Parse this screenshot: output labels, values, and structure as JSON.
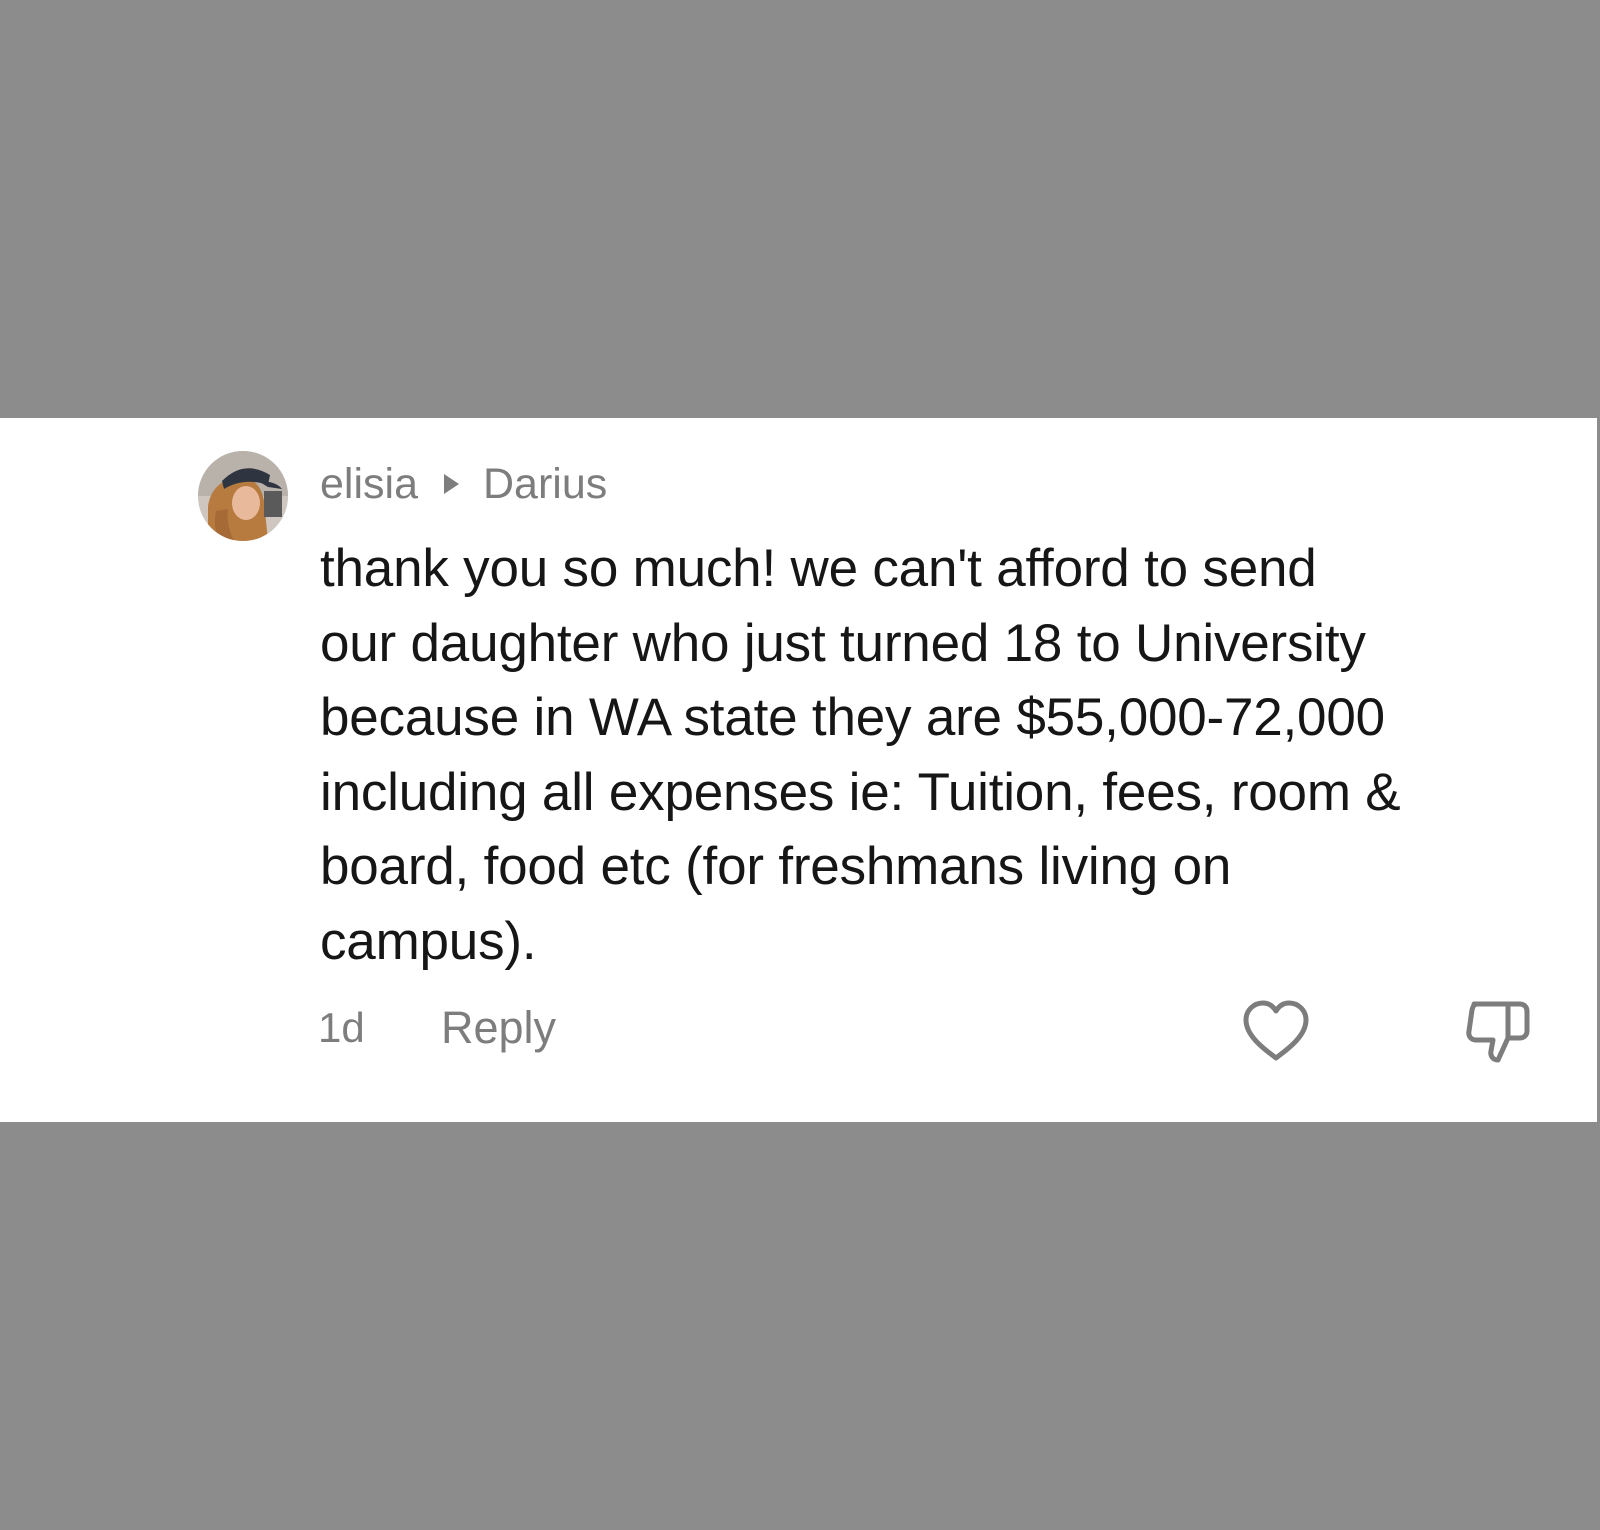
{
  "comment": {
    "author": "elisia",
    "reply_to": "Darius",
    "text_lines": [
      "thank you so much! we can't afford to send",
      "our daughter who just turned 18 to University",
      "because in WA state they are $55,000-72,000",
      "including all expenses ie: Tuition, fees, room &",
      "board, food etc (for freshmans living on",
      "campus)."
    ],
    "time": "1d",
    "reply_label": "Reply",
    "icons": {
      "avatar": "avatar-photo",
      "reply_arrow": "triangle-right-icon",
      "like": "heart-outline-icon",
      "dislike": "thumbs-down-outline-icon"
    }
  },
  "colors": {
    "background": "#8c8c8c",
    "card": "#ffffff",
    "secondary_text": "#7d7d7d",
    "primary_text": "#161616"
  }
}
